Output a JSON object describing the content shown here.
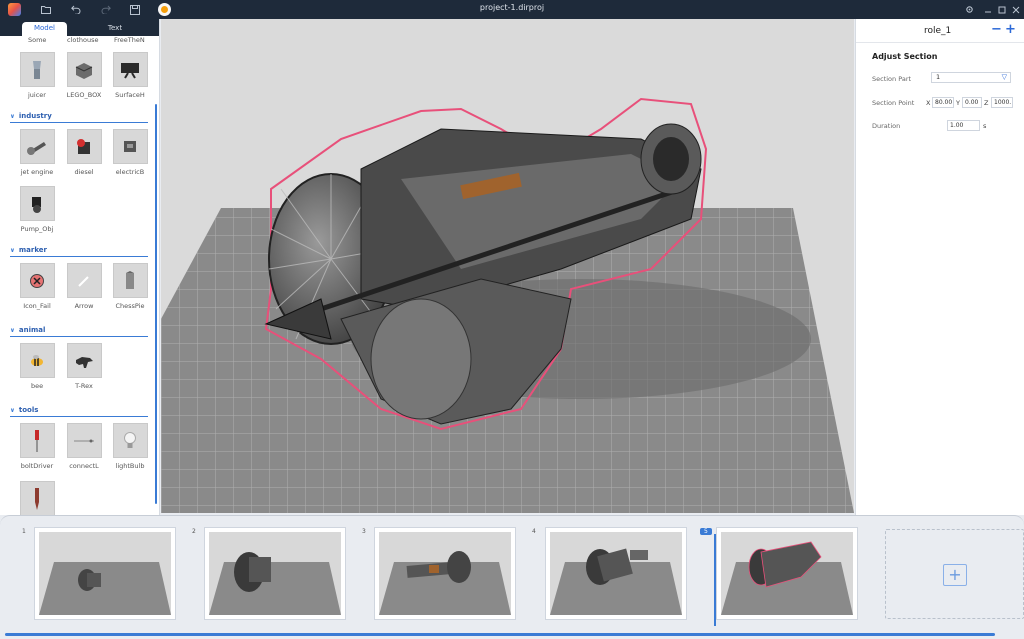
{
  "window": {
    "title": "project-1.dirproj"
  },
  "toolbar": {
    "icons": [
      "app-logo",
      "folder-icon",
      "undo-icon",
      "redo-icon",
      "save-icon",
      "play-icon"
    ],
    "window_controls": [
      "settings-icon",
      "minimize-icon",
      "maximize-icon",
      "close-icon"
    ]
  },
  "library": {
    "tabs": [
      {
        "label": "Model",
        "active": true
      },
      {
        "label": "Text",
        "active": false
      }
    ],
    "top_row_labels": [
      "Some",
      "clothouse",
      "FreeTheN"
    ],
    "misc_items": [
      {
        "label": "juicer",
        "icon": "juicer-icon"
      },
      {
        "label": "LEGO_BOX",
        "icon": "lego-icon"
      },
      {
        "label": "SurfaceH",
        "icon": "surface-icon"
      }
    ],
    "categories": [
      {
        "name": "industry",
        "items": [
          {
            "label": "jet engine",
            "icon": "jet-engine-icon"
          },
          {
            "label": "diesel",
            "icon": "diesel-icon"
          },
          {
            "label": "electricB",
            "icon": "electric-box-icon"
          },
          {
            "label": "Pump_Obj",
            "icon": "pump-icon"
          }
        ]
      },
      {
        "name": "marker",
        "items": [
          {
            "label": "Icon_Fail",
            "icon": "fail-icon"
          },
          {
            "label": "Arrow",
            "icon": "arrow-icon"
          },
          {
            "label": "ChessPie",
            "icon": "chess-icon"
          }
        ]
      },
      {
        "name": "animal",
        "items": [
          {
            "label": "bee",
            "icon": "bee-icon"
          },
          {
            "label": "T-Rex",
            "icon": "trex-icon"
          }
        ]
      },
      {
        "name": "tools",
        "items": [
          {
            "label": "boltDriver",
            "icon": "screwdriver-icon"
          },
          {
            "label": "connectL",
            "icon": "connector-icon"
          },
          {
            "label": "lightBulb",
            "icon": "lightbulb-icon"
          }
        ]
      }
    ]
  },
  "properties": {
    "role": "role_1",
    "minus": "−",
    "plus": "+",
    "section_title": "Adjust Section",
    "section_part_label": "Section Part",
    "section_part_value": "1",
    "section_point_label": "Section Point",
    "x_label": "X",
    "x_value": "80.00",
    "y_label": "Y",
    "y_value": "0.00",
    "z_label": "Z",
    "z_value": "1000.",
    "duration_label": "Duration",
    "duration_value": "1.00",
    "duration_unit": "s"
  },
  "timeline": {
    "frames": [
      {
        "number": "1",
        "active": false
      },
      {
        "number": "2",
        "active": false
      },
      {
        "number": "3",
        "active": false
      },
      {
        "number": "4",
        "active": false
      },
      {
        "number": "5",
        "active": true
      }
    ],
    "add_label": "+"
  },
  "colors": {
    "accent": "#3a7bd5",
    "titlebar": "#1e2a3a",
    "outline": "#e8507a"
  }
}
